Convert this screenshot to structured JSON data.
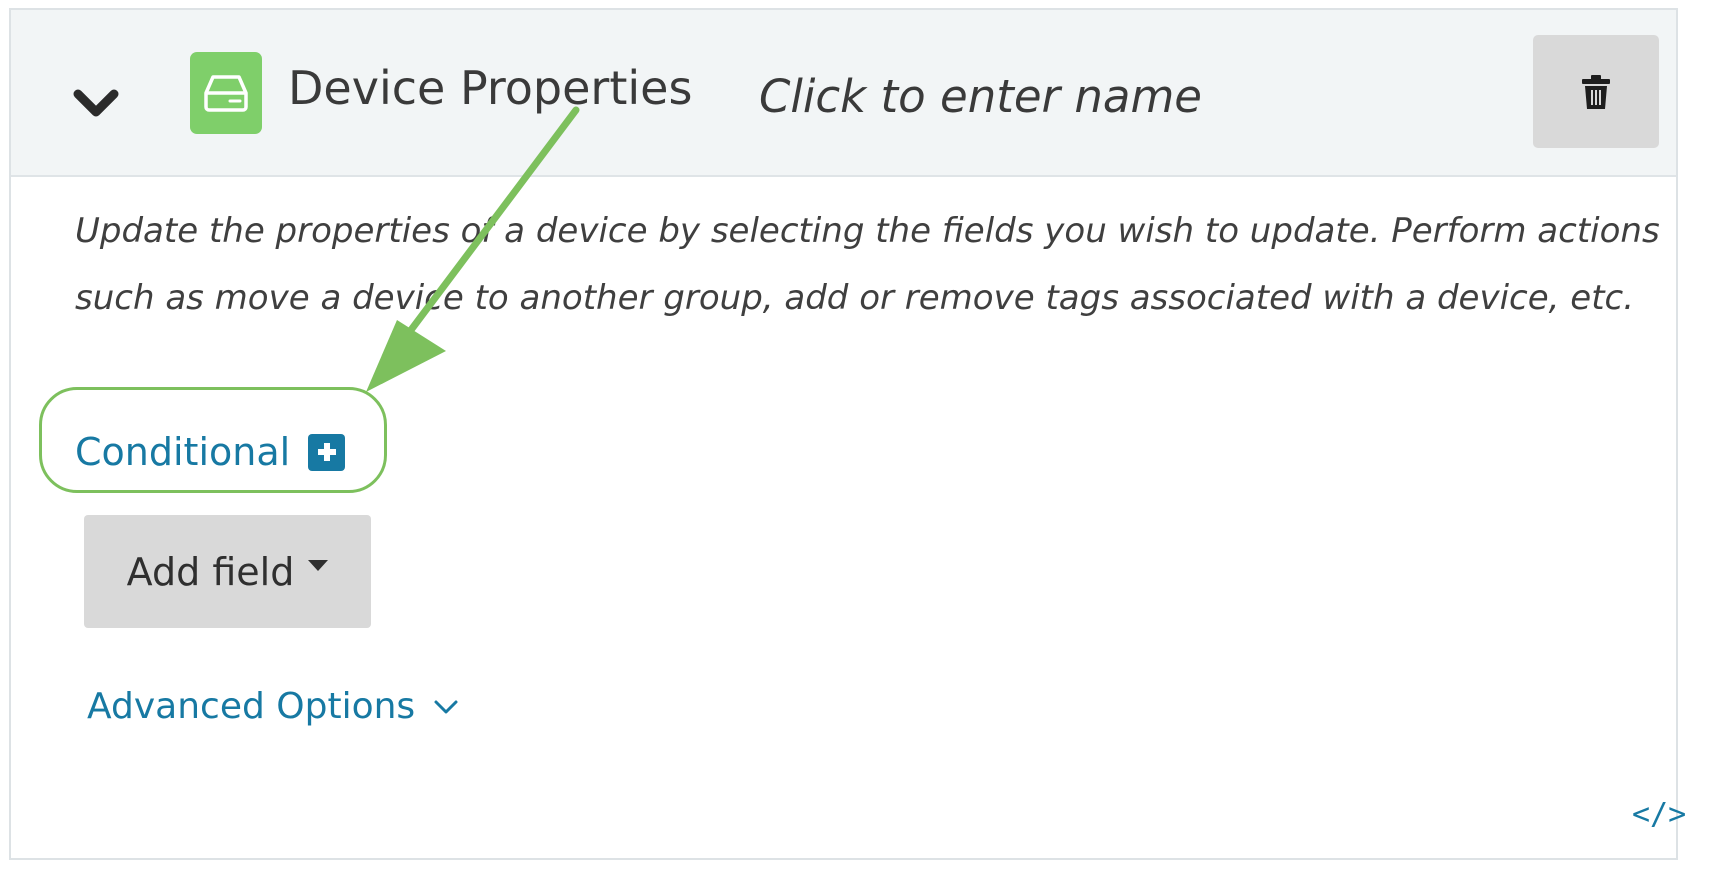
{
  "block": {
    "title": "Device Properties",
    "name_placeholder": "Click to enter name",
    "description": "Update the properties of a device by selecting the fields you wish to update. Perform actions such as move a device to another group, add or remove tags associated with a device, etc.",
    "conditional_label": "Conditional",
    "add_field_label": "Add field",
    "advanced_options_label": "Advanced Options",
    "code_toggle_label": "</>"
  },
  "icons": {
    "collapse": "chevron-down-icon",
    "device": "drive-icon",
    "delete": "trash-icon",
    "conditional_add": "plus-square-icon",
    "advanced": "chevron-down-icon",
    "code": "code-icon"
  },
  "colors": {
    "accent": "#1779a3",
    "device_icon_bg": "#7fcf6a",
    "annotation": "#7dc05d",
    "header_bg": "#f2f5f6",
    "button_bg": "#d9d9d9"
  }
}
